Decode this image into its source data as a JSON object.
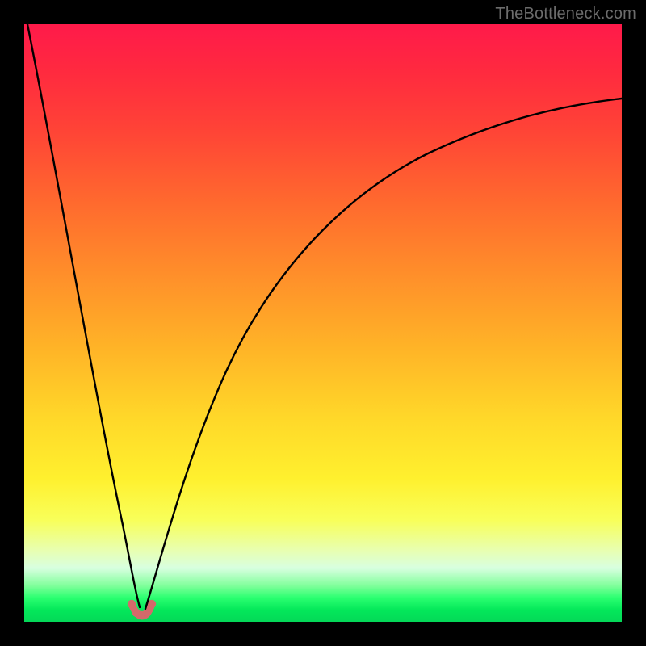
{
  "watermark": "TheBottleneck.com",
  "chart_data": {
    "type": "line",
    "title": "",
    "xlabel": "",
    "ylabel": "",
    "xlim": [
      0,
      100
    ],
    "ylim": [
      0,
      100
    ],
    "grid": false,
    "legend": false,
    "series": [
      {
        "name": "left-curve",
        "x": [
          0,
          2,
          4,
          6,
          8,
          10,
          12,
          14,
          15,
          16,
          17,
          17.5,
          18,
          18.5
        ],
        "values": [
          100,
          90,
          80,
          70,
          60,
          49,
          38,
          25,
          18,
          11,
          5,
          2,
          1,
          0
        ]
      },
      {
        "name": "right-curve",
        "x": [
          20,
          21,
          22,
          24,
          26,
          30,
          34,
          40,
          46,
          54,
          62,
          72,
          84,
          100
        ],
        "values": [
          0,
          2,
          5,
          12,
          19,
          31,
          41,
          52,
          60,
          67,
          73,
          78,
          82,
          85
        ]
      },
      {
        "name": "basin-markers",
        "type": "scatter",
        "x": [
          17.6,
          18.3,
          19.4,
          20.2,
          20.8
        ],
        "values": [
          2.0,
          0.8,
          0.7,
          0.8,
          2.2
        ],
        "color": "#d46a6a"
      }
    ]
  }
}
